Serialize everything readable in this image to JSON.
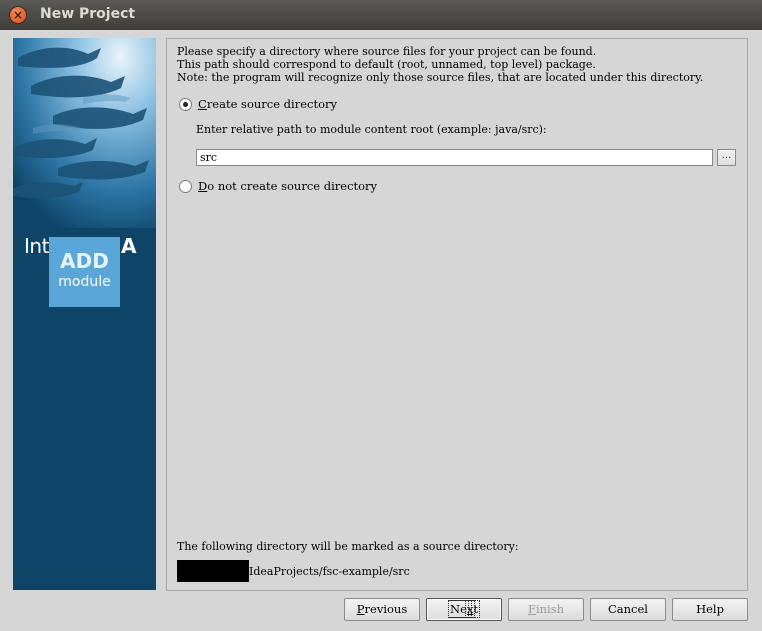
{
  "window": {
    "title": "New Project",
    "close_glyph": "×"
  },
  "banner": {
    "logo_light": "IntelliJ",
    "logo_bold": "IDEA",
    "badge_top": "ADD",
    "badge_bottom": "module"
  },
  "info": {
    "line1": "Please specify a directory where source files for your project can be found.",
    "line2": "This path should correspond to default (root, unnamed, top level) package.",
    "line3": "Note: the program will recognize only those source files, that are located under this directory."
  },
  "options": {
    "create": {
      "mnemonic": "C",
      "rest": "reate source directory",
      "checked": true
    },
    "path_label": "Enter relative path to module content root  (example: java/src):",
    "path_value": "src",
    "browse_label": "...",
    "no_create": {
      "mnemonic": "D",
      "rest": "o not create source directory",
      "checked": false
    }
  },
  "result": {
    "label": "The following directory will be marked as a source directory:",
    "path_suffix": "IdeaProjects/fsc-example/src"
  },
  "buttons": {
    "previous": {
      "mnemonic": "P",
      "rest": "revious"
    },
    "next": {
      "pre": "Ne",
      "mnemonic": "x",
      "rest": "t"
    },
    "finish": {
      "mnemonic": "F",
      "rest": "inish"
    },
    "cancel": "Cancel",
    "help": "Help"
  }
}
